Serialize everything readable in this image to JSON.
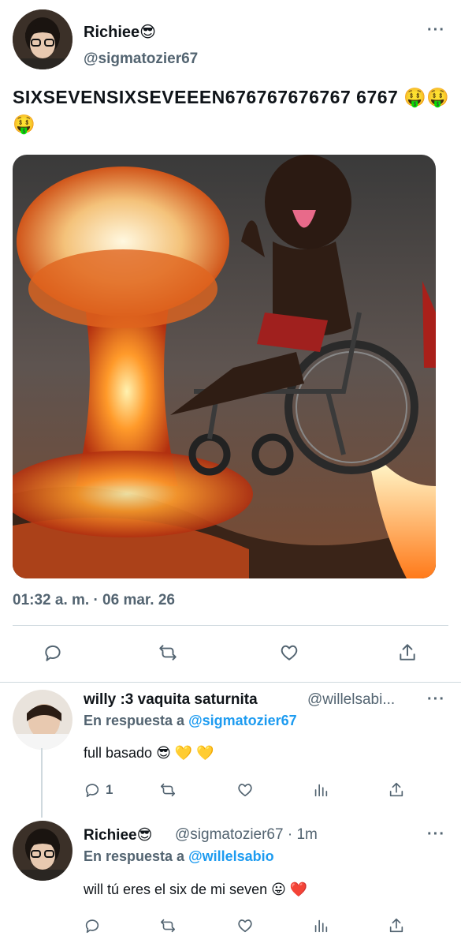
{
  "main_tweet": {
    "author_name": "Richiee😎",
    "author_handle": "@sigmatozier67",
    "text": "SIXSEVENSIXSEVEEEN676767676767 6767 🤑🤑🤑",
    "timestamp": "01:32 a. m. · 06 mar. 26",
    "more_label": "···"
  },
  "replies": [
    {
      "author_name": "willy :3 vaquita saturnita",
      "author_handle": "@willelsabi...",
      "reply_prefix": "En respuesta a ",
      "reply_mention": "@sigmatozier67",
      "text": "full basado 😎 💛 💛",
      "reply_count": "1",
      "more_label": "···"
    },
    {
      "author_name": "Richiee😎",
      "author_handle": "@sigmatozier67 · 1m",
      "reply_prefix": "En respuesta a ",
      "reply_mention": "@willelsabio",
      "text": "will tú eres el six de mi seven 😛 ❤️",
      "more_label": "···"
    }
  ],
  "colors": {
    "accent": "#1d9bf0",
    "secondary_text": "#536471",
    "divider": "#cfd9de"
  },
  "icons": [
    "reply-icon",
    "retweet-icon",
    "like-icon",
    "views-icon",
    "share-icon",
    "more-icon"
  ]
}
